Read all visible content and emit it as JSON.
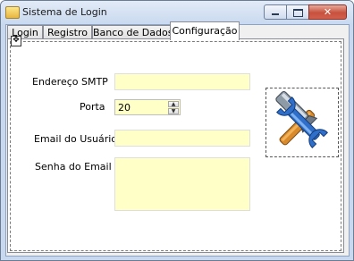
{
  "window": {
    "title": "Sistema de Login",
    "icons": {
      "app": "app-icon",
      "minimize": "minimize-icon",
      "maximize": "maximize-icon",
      "close": "close-icon"
    }
  },
  "tabs": [
    {
      "label": "Login",
      "selected": false
    },
    {
      "label": "Registro",
      "selected": false
    },
    {
      "label": "Banco de Dados",
      "selected": false
    },
    {
      "label": "Configuração",
      "selected": true
    }
  ],
  "form": {
    "smtp_label": "Endereço SMTP",
    "smtp_value": "",
    "port_label": "Porta",
    "port_value": "20",
    "email_label": "Email do Usuário",
    "email_value": "",
    "password_label": "Senha do Email",
    "password_value": ""
  },
  "picture": {
    "icon": "tools-icon"
  },
  "colors": {
    "input_background": "#ffffc8",
    "window_frame": "#c8d8ee",
    "close_button": "#c7513e"
  }
}
